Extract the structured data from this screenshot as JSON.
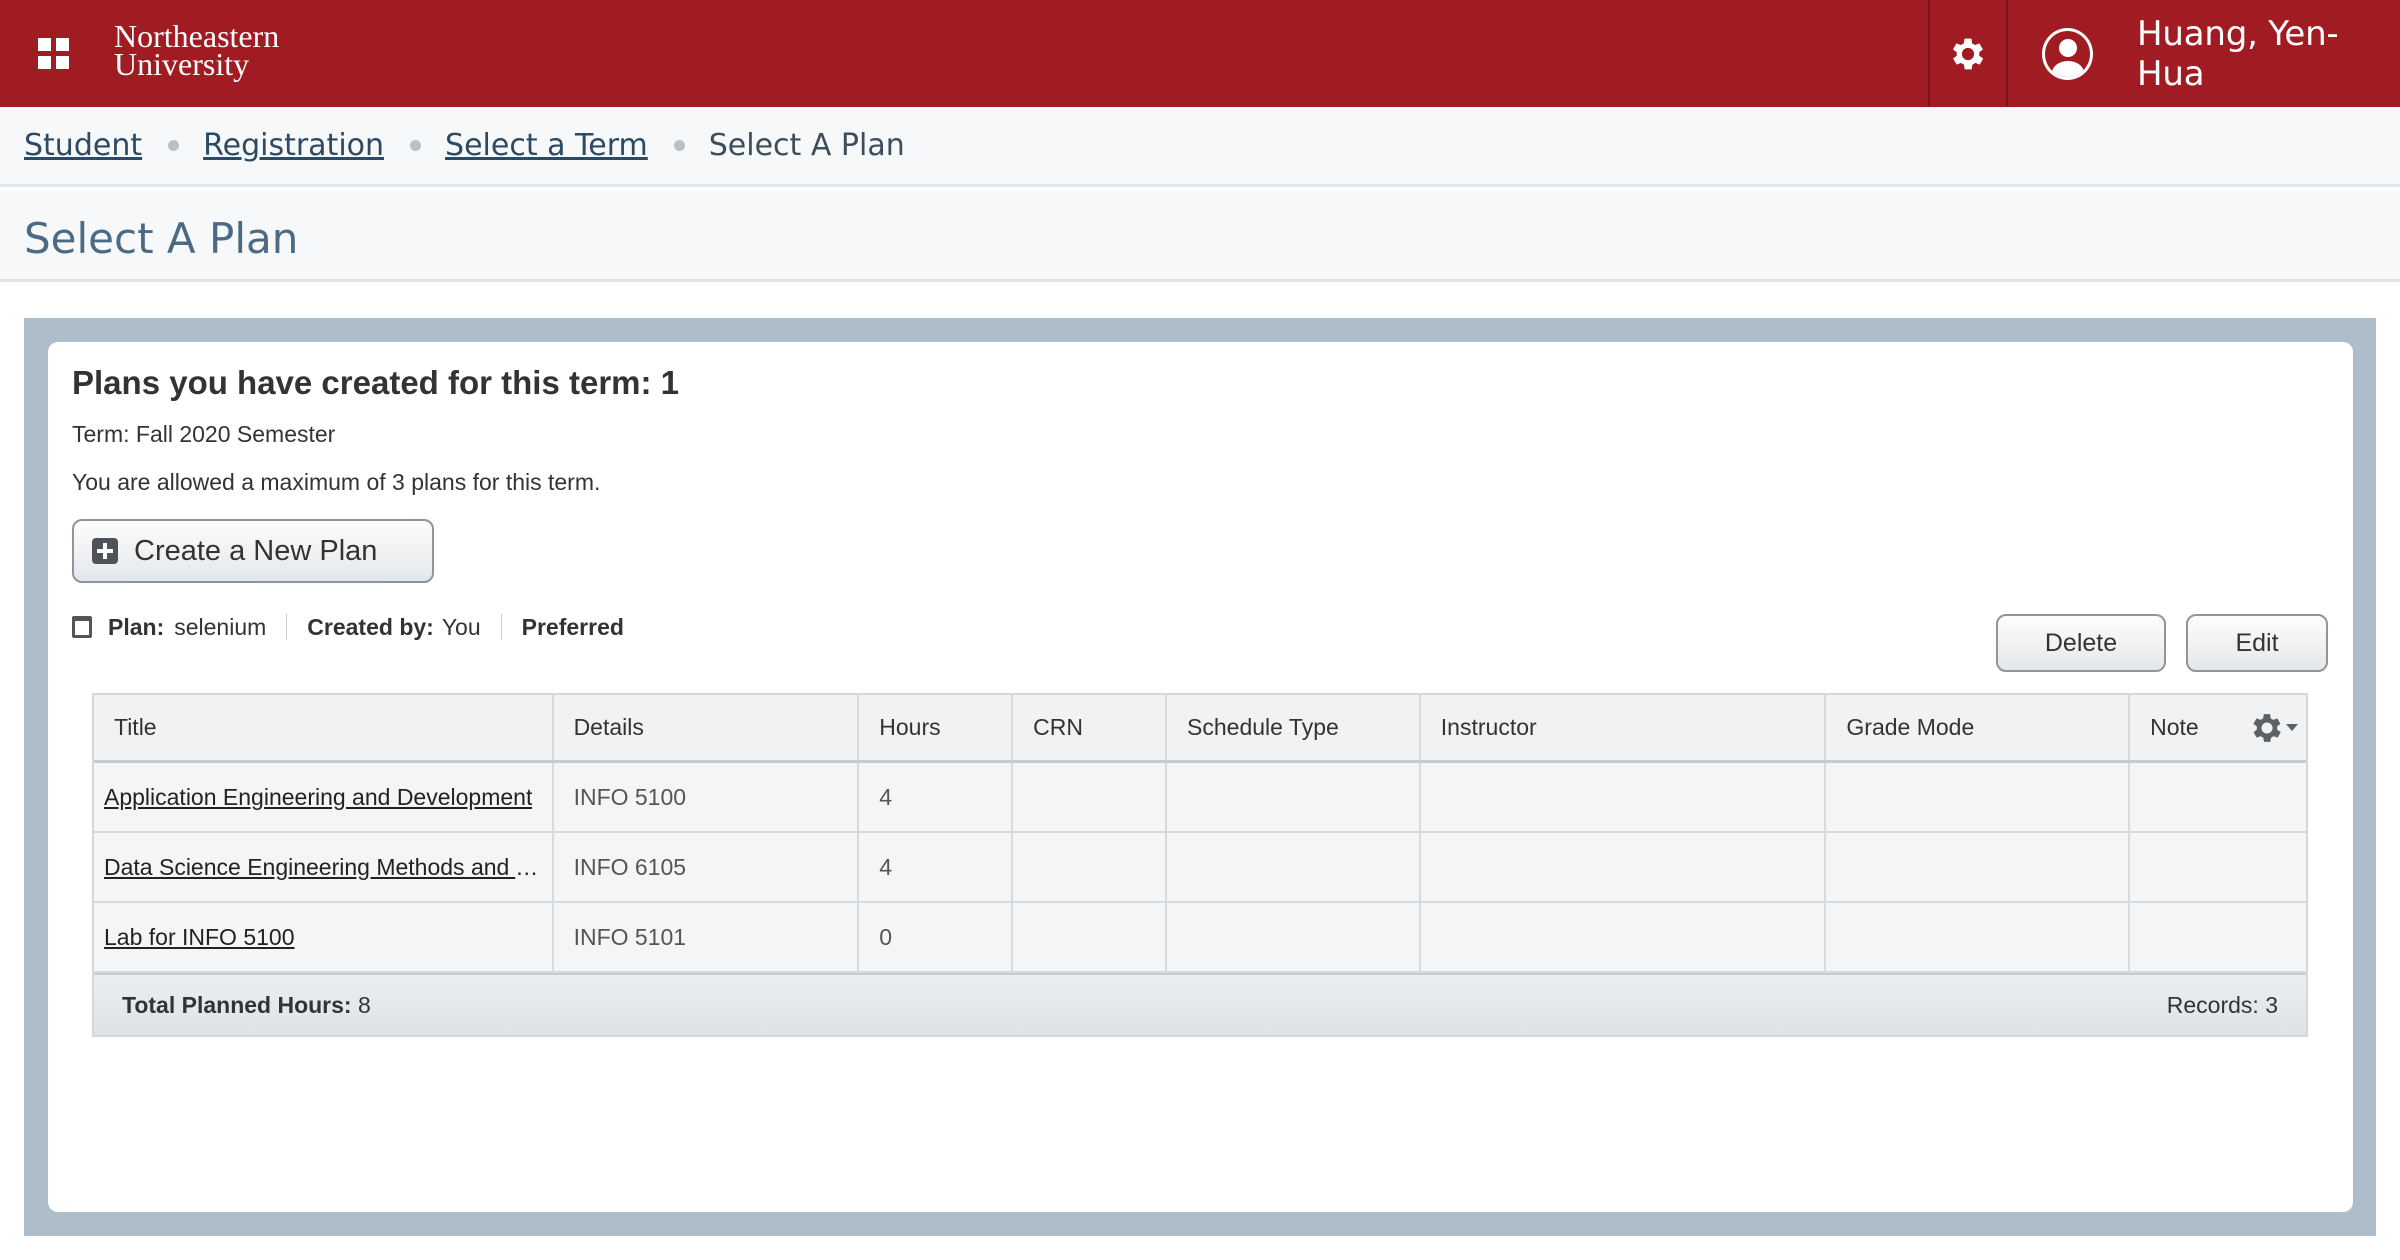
{
  "header": {
    "logo_line1": "Northeastern",
    "logo_line2": "University",
    "user_name": "Huang, Yen-Hua",
    "brand_color": "#a11c22"
  },
  "breadcrumb": {
    "items": [
      "Student",
      "Registration",
      "Select a Term"
    ],
    "current": "Select A Plan"
  },
  "page": {
    "title": "Select A Plan"
  },
  "plans": {
    "heading": "Plans you have created for this term: 1",
    "term": "Term: Fall 2020 Semester",
    "max_note": "You are allowed a maximum of 3 plans for this term.",
    "create_label": "Create a New Plan",
    "plan_label": "Plan:",
    "plan_name": "selenium",
    "created_by_label": "Created by:",
    "created_by": "You",
    "preferred": "Preferred",
    "delete_label": "Delete",
    "edit_label": "Edit"
  },
  "table": {
    "columns": [
      "Title",
      "Details",
      "Hours",
      "CRN",
      "Schedule Type",
      "Instructor",
      "Grade Mode",
      "Note"
    ],
    "rows": [
      {
        "title": "Application Engineering and Development",
        "details": "INFO 5100",
        "hours": "4",
        "crn": "",
        "schedule_type": "",
        "instructor": "",
        "grade_mode": "",
        "note": ""
      },
      {
        "title": "Data Science Engineering Methods and Tools",
        "details": "INFO 6105",
        "hours": "4",
        "crn": "",
        "schedule_type": "",
        "instructor": "",
        "grade_mode": "",
        "note": ""
      },
      {
        "title": "Lab for INFO 5100",
        "details": "INFO 5101",
        "hours": "0",
        "crn": "",
        "schedule_type": "",
        "instructor": "",
        "grade_mode": "",
        "note": ""
      }
    ],
    "total_label": "Total Planned Hours:",
    "total_value": "8",
    "records_label": "Records:",
    "records_value": "3"
  },
  "icons": {
    "apps": "apps-grid-icon",
    "settings": "gear-icon",
    "user": "user-avatar-icon",
    "create": "plus-square-icon",
    "plan": "clipboard-icon",
    "column_settings": "gear-dropdown-icon"
  }
}
